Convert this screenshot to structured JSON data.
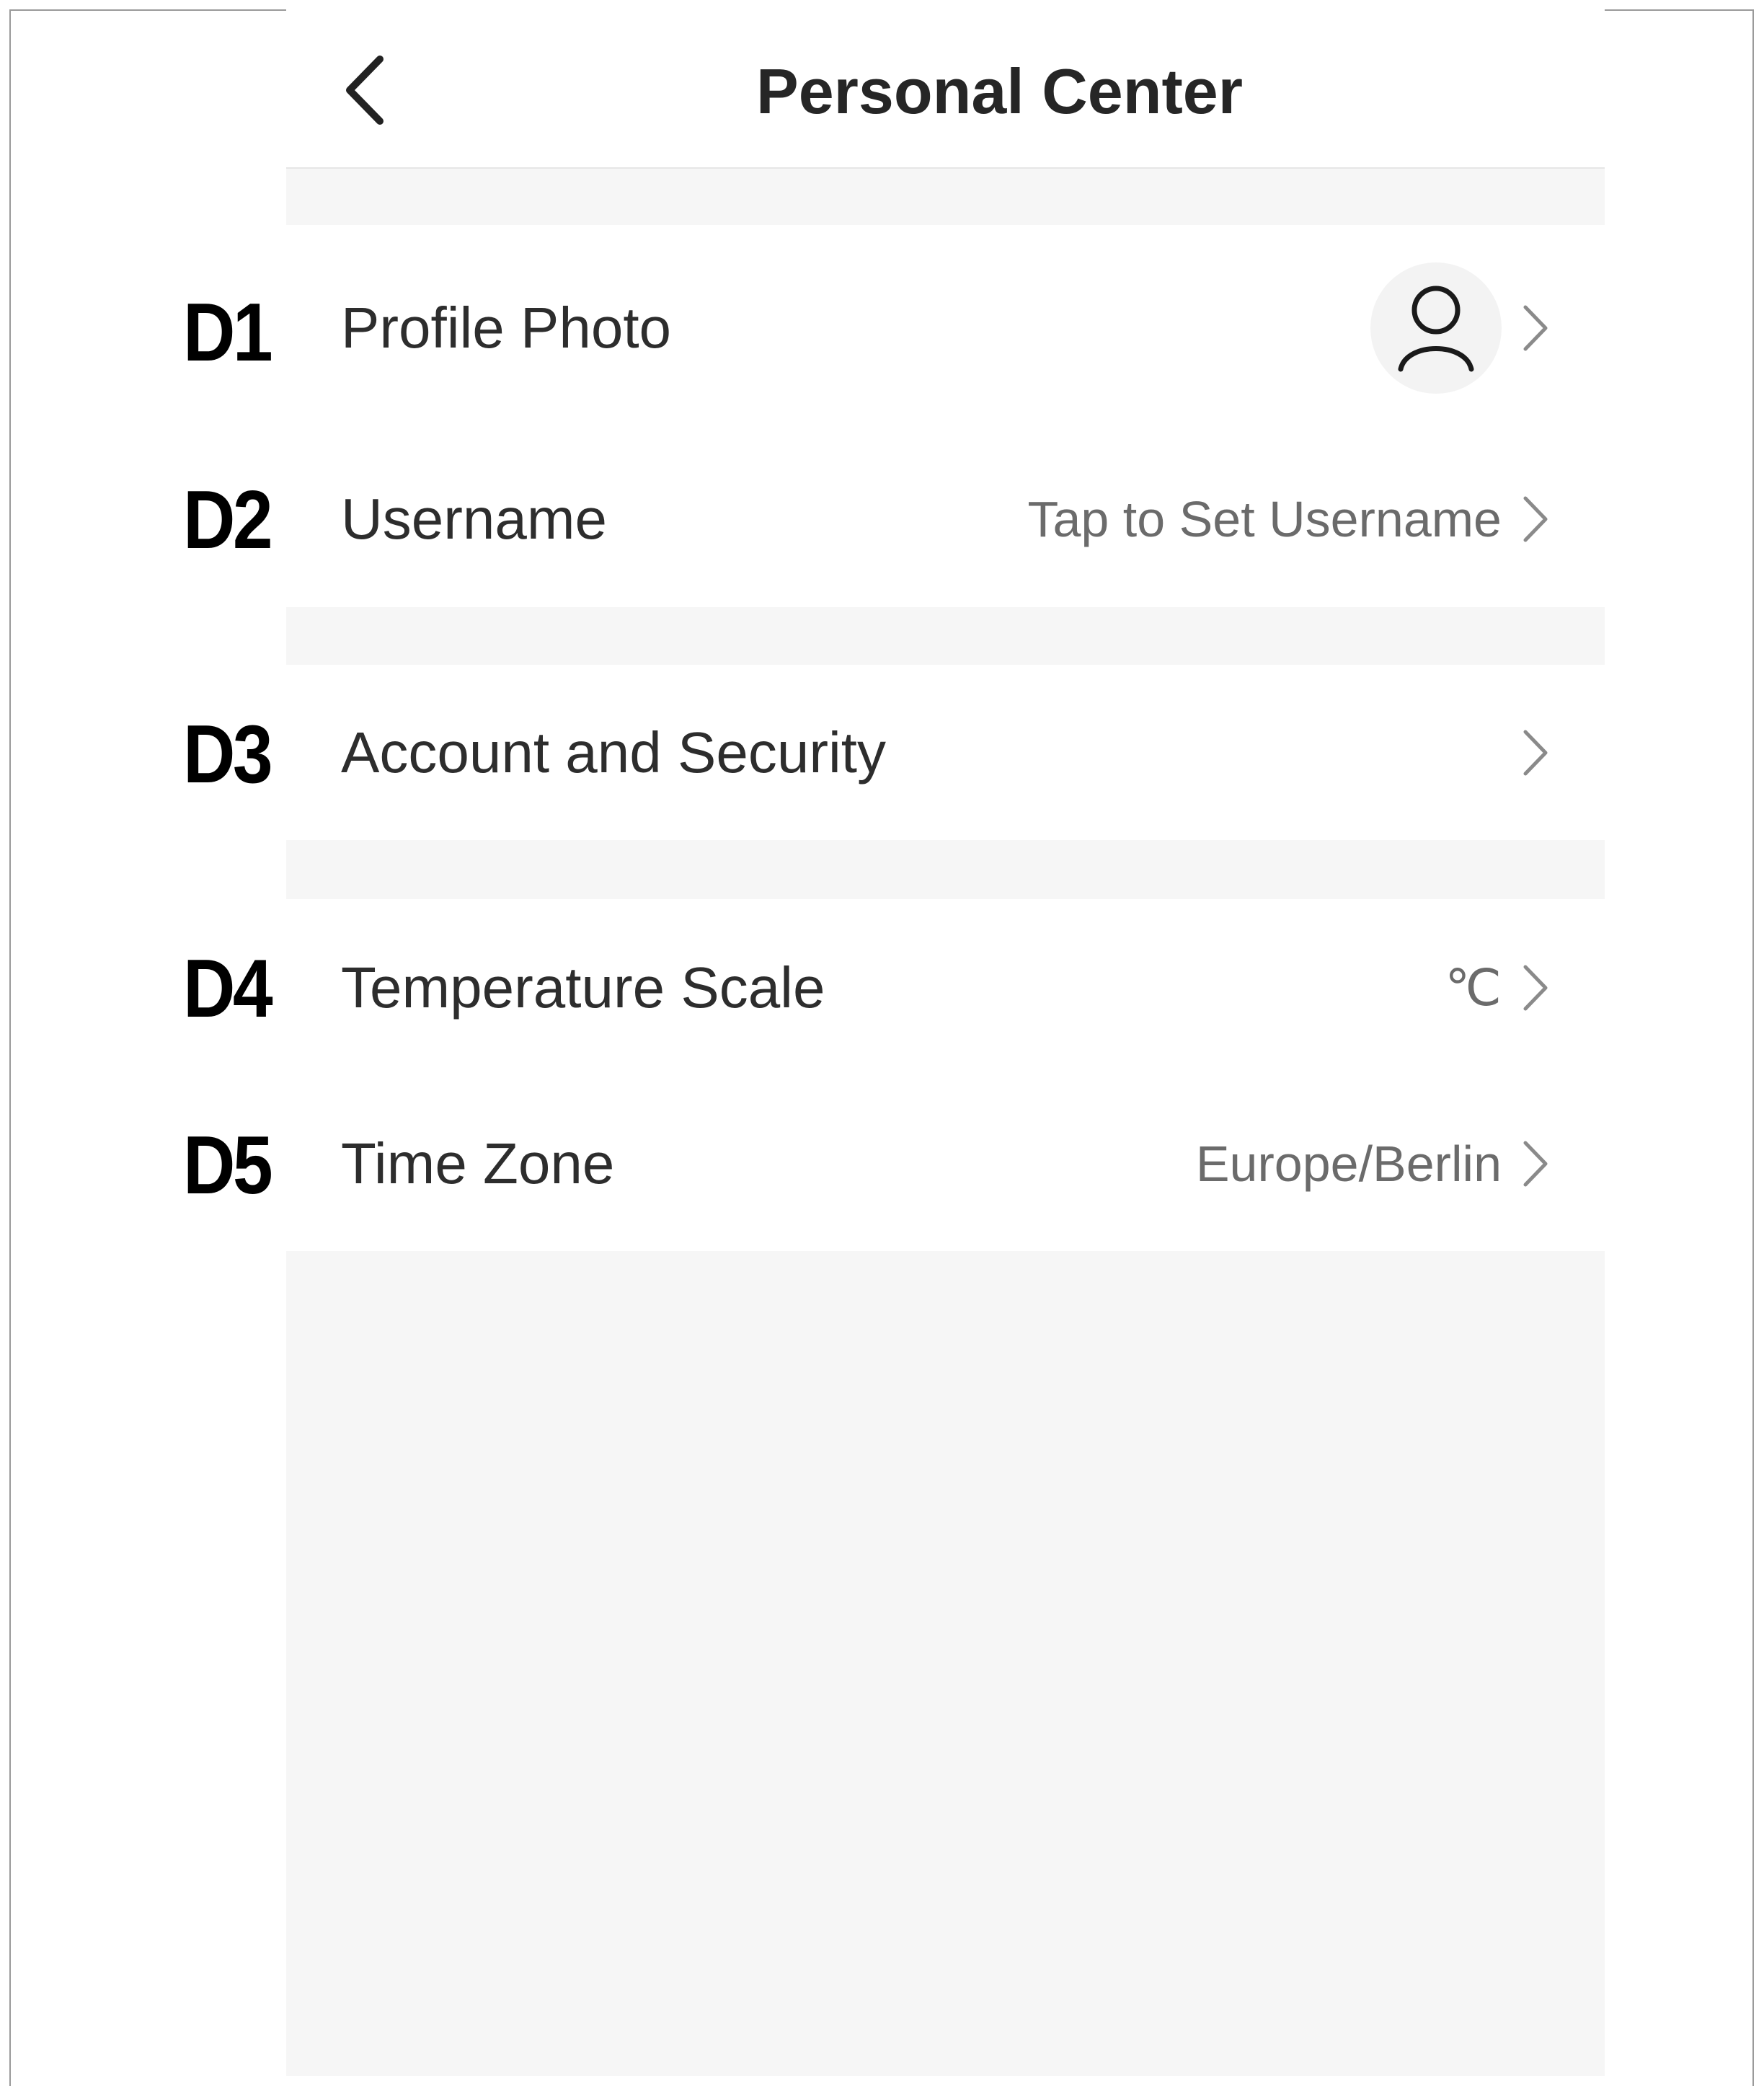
{
  "header": {
    "title": "Personal Center",
    "back_icon": "chevron-left-icon"
  },
  "rows": [
    {
      "marker": "D1",
      "label": "Profile Photo",
      "value": "",
      "icon": "user-avatar-icon"
    },
    {
      "marker": "D2",
      "label": "Username",
      "value": "Tap to Set Username"
    },
    {
      "marker": "D3",
      "label": "Account and Security",
      "value": ""
    },
    {
      "marker": "D4",
      "label": "Temperature Scale",
      "value": "℃"
    },
    {
      "marker": "D5",
      "label": "Time Zone",
      "value": "Europe/Berlin"
    }
  ],
  "colors": {
    "background": "#ffffff",
    "section_gap": "#f6f6f6",
    "label_text": "#2d2d2d",
    "value_text": "#6b6b6b",
    "chevron": "#8a8a8a"
  }
}
